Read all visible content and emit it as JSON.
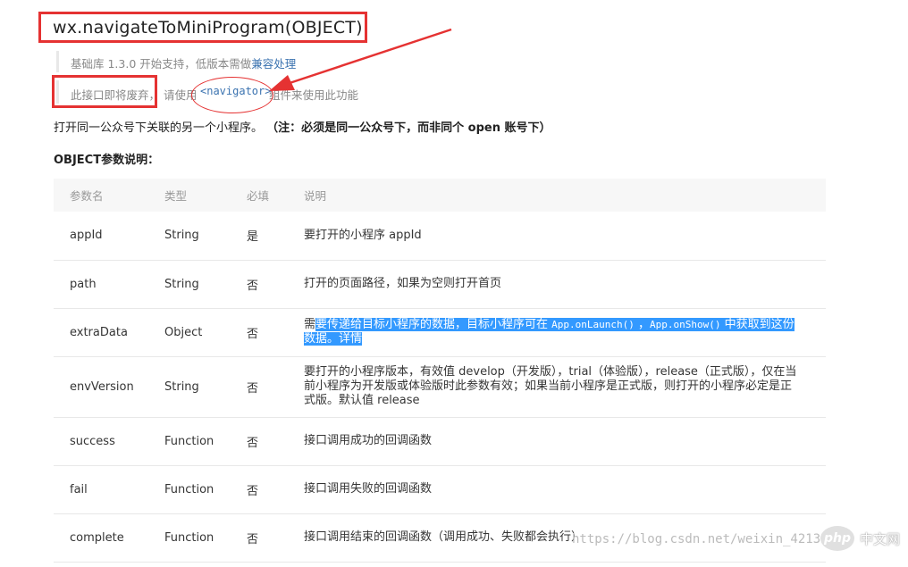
{
  "title": "wx.navigateToMiniProgram(OBJECT)",
  "note1": {
    "text": "基础库 1.3.0 开始支持，低版本需做",
    "link": "兼容处理"
  },
  "note2": {
    "text1": "此接口即将废弃，",
    "text2": "请使用",
    "code": "<navigator>",
    "text3": "组件来使用此功能"
  },
  "description": {
    "text": "打开同一公众号下关联的另一个小程序。",
    "bold": "（注：必须是同一公众号下，而非同个 open 账号下）"
  },
  "section_title": "OBJECT参数说明：",
  "table": {
    "headers": [
      "参数名",
      "类型",
      "必填",
      "说明"
    ],
    "rows": [
      {
        "name": "appId",
        "type": "String",
        "required": "是",
        "desc": "要打开的小程序 appId"
      },
      {
        "name": "path",
        "type": "String",
        "required": "否",
        "desc": "打开的页面路径，如果为空则打开首页"
      },
      {
        "name": "extraData",
        "type": "Object",
        "required": "否",
        "desc_a": "需",
        "desc_b": "要传递给目标小程序的数据，目标小程序可在 ",
        "code1": "App.onLaunch()",
        "desc_c": " ，",
        "code2": "App.onShow()",
        "desc_d": " 中获取到这份",
        "desc_e": "数据。详情"
      },
      {
        "name": "envVersion",
        "type": "String",
        "required": "否",
        "desc": "要打开的小程序版本，有效值 develop（开发版），trial（体验版），release（正式版），仅在当前小程序为开发版或体验版时此参数有效；如果当前小程序是正式版，则打开的小程序必定是正式版。默认值 release"
      },
      {
        "name": "success",
        "type": "Function",
        "required": "否",
        "desc": "接口调用成功的回调函数"
      },
      {
        "name": "fail",
        "type": "Function",
        "required": "否",
        "desc": "接口调用失败的回调函数"
      },
      {
        "name": "complete",
        "type": "Function",
        "required": "否",
        "desc": "接口调用结束的回调函数（调用成功、失败都会执行）"
      }
    ]
  },
  "watermark": "https://blog.csdn.net/weixin_42133469",
  "php_logo": "php",
  "php_site": "中文网",
  "colors": {
    "annotation_red": "#e53232",
    "link_blue": "#3b73b0",
    "selection_blue": "#3399ff"
  }
}
